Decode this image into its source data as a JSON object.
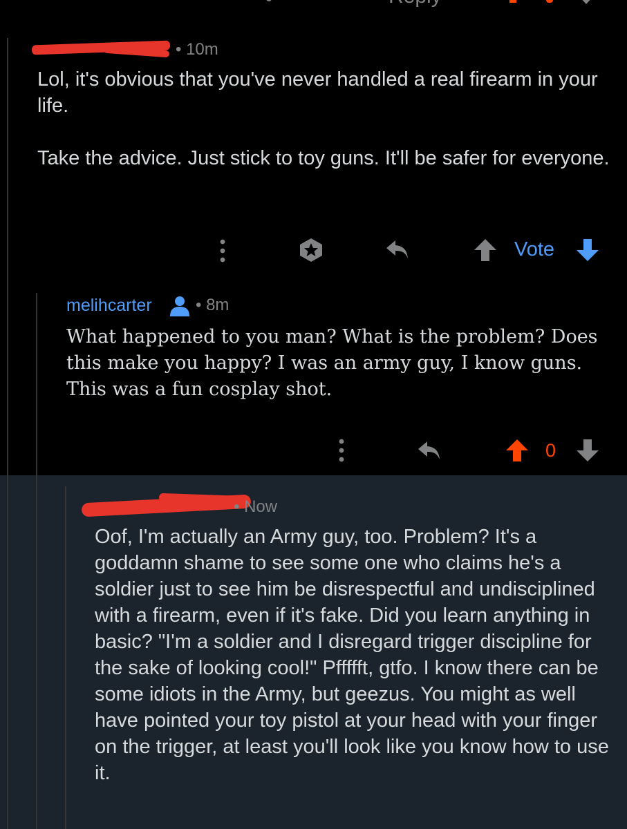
{
  "top_bar": {
    "reply_label": "Reply"
  },
  "comment1": {
    "time": "10m",
    "paragraphs": [
      "Lol, it's obvious that you've never handled a real firearm in your life.",
      "Take the advice. Just stick to toy guns. It'll be safer for everyone."
    ],
    "vote_label": "Vote"
  },
  "comment2": {
    "username": "melihcarter",
    "time": "8m",
    "text": "What happened to you man? What is the problem? Does this make you happy? I was an army guy, I know guns. This was a fun cosplay shot.",
    "score": "0"
  },
  "comment3": {
    "time": "Now",
    "text": "Oof, I'm actually an Army guy, too. Problem? It's a goddamn shame to see some one who claims he's a soldier just to see him be disrespectful and undisciplined with a firearm, even if it's fake. Did you learn anything in basic? \"I'm a soldier and I disregard trigger discipline for the sake of looking cool!\" Pffffft, gtfo. I know there can be some idiots in the Army, but geezus. You might as well have pointed your toy pistol at your head with your finger on the trigger, at least you'll look like you know how to use it."
  },
  "colors": {
    "accent": "#4f9cf9",
    "upvote": "#ff4500",
    "redaction": "#e8352b",
    "highlight_bg": "#1b242c"
  }
}
